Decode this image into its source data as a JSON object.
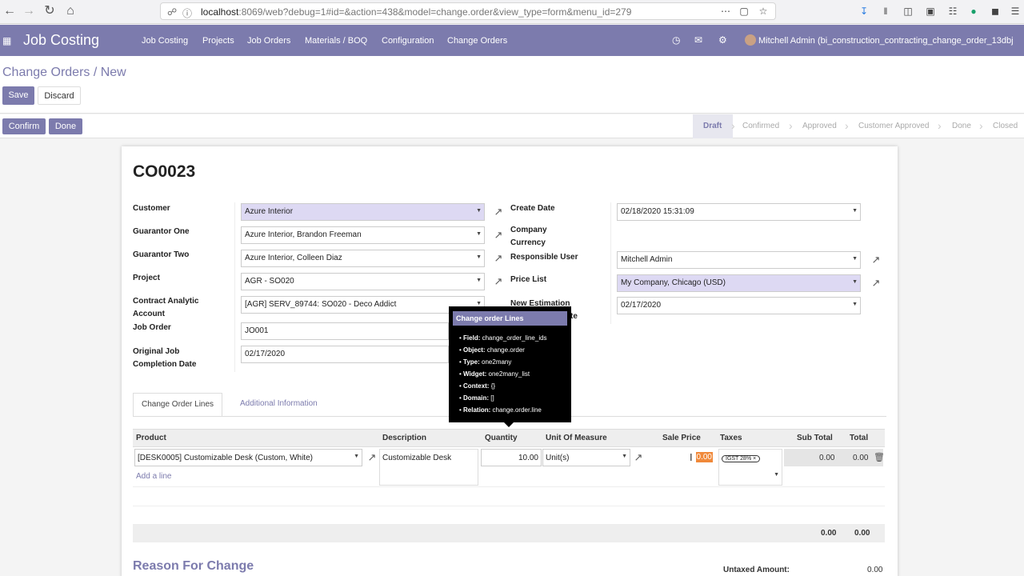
{
  "browser": {
    "url_prefix": "localhost",
    "url_rest": ":8069/web?debug=1#id=&action=438&model=change.order&view_type=form&menu_id=279"
  },
  "navbar": {
    "brand": "Job Costing",
    "menu": [
      "Job Costing",
      "Projects",
      "Job Orders",
      "Materials / BOQ",
      "Configuration",
      "Change Orders"
    ],
    "user": "Mitchell Admin (bi_construction_contracting_change_order_13dbj"
  },
  "control_panel": {
    "breadcrumb": "Change Orders / New",
    "save": "Save",
    "discard": "Discard",
    "confirm": "Confirm",
    "done": "Done",
    "statuses": [
      "Draft",
      "Confirmed",
      "Approved",
      "Customer Approved",
      "Done",
      "Closed"
    ]
  },
  "form": {
    "title": "CO0023",
    "labels": {
      "customer": "Customer",
      "guarantor_one": "Guarantor One",
      "guarantor_two": "Guarantor Two",
      "project": "Project",
      "analytic_1": "Contract Analytic",
      "analytic_2": "Account",
      "job_order": "Job Order",
      "orig_date_1": "Original Job",
      "orig_date_2": "Completion Date",
      "create_date": "Create Date",
      "currency_1": "Company",
      "currency_2": "Currency",
      "responsible": "Responsible User",
      "pricelist": "Price List",
      "new_estimation": "New Estimation",
      "date_trail": "te"
    },
    "values": {
      "customer": "Azure Interior",
      "guarantor_one": "Azure Interior, Brandon Freeman",
      "guarantor_two": "Azure Interior, Colleen Diaz",
      "project": "AGR - SO020",
      "analytic": "[AGR] SERV_89744: SO020 - Deco Addict",
      "job_order": "JO001",
      "orig_date": "02/17/2020",
      "create_date": "02/18/2020 15:31:09",
      "responsible": "Mitchell Admin",
      "pricelist": "My Company, Chicago (USD)",
      "new_estimation": "02/17/2020"
    }
  },
  "tabs": [
    "Change Order Lines",
    "Additional Information"
  ],
  "table": {
    "headers": [
      "Product",
      "Description",
      "Quantity",
      "Unit Of Measure",
      "Sale Price",
      "Taxes",
      "Sub Total",
      "Total"
    ],
    "row": {
      "product": "[DESK0005] Customizable Desk (Custom, White)",
      "description": "Customizable Desk",
      "quantity": "10.00",
      "uom": "Unit(s)",
      "sale_price": "0.00",
      "tax": "IGST 28%",
      "subtotal": "0.00",
      "total": "0.00"
    },
    "add_line": "Add a line",
    "footer_subtotal": "0.00",
    "footer_total": "0.00"
  },
  "reason": {
    "title": "Reason For Change",
    "untaxed_label": "Untaxed Amount:",
    "untaxed_value": "0.00"
  },
  "tooltip": {
    "title": "Change order Lines",
    "items": [
      {
        "key": "Field:",
        "val": "change_order_line_ids"
      },
      {
        "key": "Object:",
        "val": "change.order"
      },
      {
        "key": "Type:",
        "val": "one2many"
      },
      {
        "key": "Widget:",
        "val": "one2many_list"
      },
      {
        "key": "Context:",
        "val": "{}"
      },
      {
        "key": "Domain:",
        "val": "[]"
      },
      {
        "key": "Relation:",
        "val": "change.order.line"
      }
    ]
  },
  "colors": {
    "brand": "#7c7bad",
    "highlight": "#ddd9f3",
    "sale_price_highlight": "#f0893a"
  }
}
